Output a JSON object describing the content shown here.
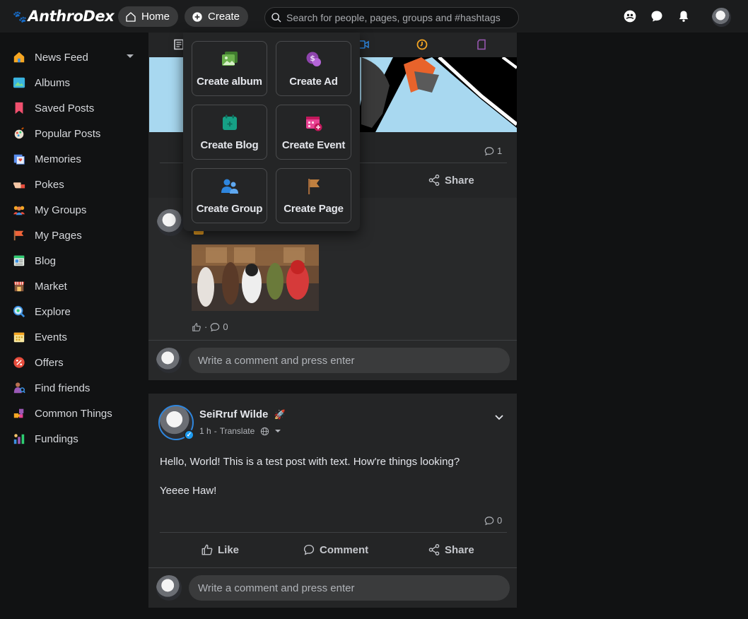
{
  "app": {
    "logo_text": "AnthroDex"
  },
  "header": {
    "home_label": "Home",
    "create_label": "Create",
    "search_placeholder": "Search for people, pages, groups and #hashtags"
  },
  "sidebar": {
    "items": [
      {
        "label": "News Feed",
        "icon": "news-feed-icon"
      },
      {
        "label": "Albums",
        "icon": "albums-icon"
      },
      {
        "label": "Saved Posts",
        "icon": "bookmark-icon"
      },
      {
        "label": "Popular Posts",
        "icon": "popular-icon"
      },
      {
        "label": "Memories",
        "icon": "memories-icon"
      },
      {
        "label": "Pokes",
        "icon": "poke-icon"
      },
      {
        "label": "My Groups",
        "icon": "groups-icon"
      },
      {
        "label": "My Pages",
        "icon": "pages-icon"
      },
      {
        "label": "Blog",
        "icon": "blog-icon"
      },
      {
        "label": "Market",
        "icon": "market-icon"
      },
      {
        "label": "Explore",
        "icon": "explore-icon"
      },
      {
        "label": "Events",
        "icon": "events-icon"
      },
      {
        "label": "Offers",
        "icon": "offers-icon"
      },
      {
        "label": "Find friends",
        "icon": "find-friends-icon"
      },
      {
        "label": "Common Things",
        "icon": "puzzle-icon"
      },
      {
        "label": "Fundings",
        "icon": "fundings-icon"
      }
    ]
  },
  "create_menu": {
    "items": [
      {
        "label": "Create album",
        "icon": "album-icon",
        "color": "#6ab04c"
      },
      {
        "label": "Create Ad",
        "icon": "ad-icon",
        "color": "#8e44ad"
      },
      {
        "label": "Create Blog",
        "icon": "blog-icon",
        "color": "#16a085"
      },
      {
        "label": "Create Event",
        "icon": "event-icon",
        "color": "#e84393"
      },
      {
        "label": "Create Group",
        "icon": "group-icon",
        "color": "#2e86de"
      },
      {
        "label": "Create Page",
        "icon": "flag-icon",
        "color": "#c08040"
      }
    ]
  },
  "post1": {
    "comment_count": "1",
    "comment_label_partial": "t",
    "share_label": "Share"
  },
  "post2": {
    "like_count": "0",
    "comment_placeholder": "Write a comment and press enter"
  },
  "post3": {
    "author": "SeiRruf Wilde",
    "time": "1 h",
    "translate_label": "Translate",
    "text_line1": "Hello, World! This is a test post with text. How're things looking?",
    "text_line2": "Yeeee Haw!",
    "comment_count": "0",
    "like_label": "Like",
    "comment_label": "Comment",
    "share_label": "Share",
    "comment_placeholder": "Write a comment and press enter"
  },
  "colors": {
    "background": "#111213",
    "card": "#242526",
    "header": "#1b1c1d",
    "verified": "#1d9bf0"
  }
}
